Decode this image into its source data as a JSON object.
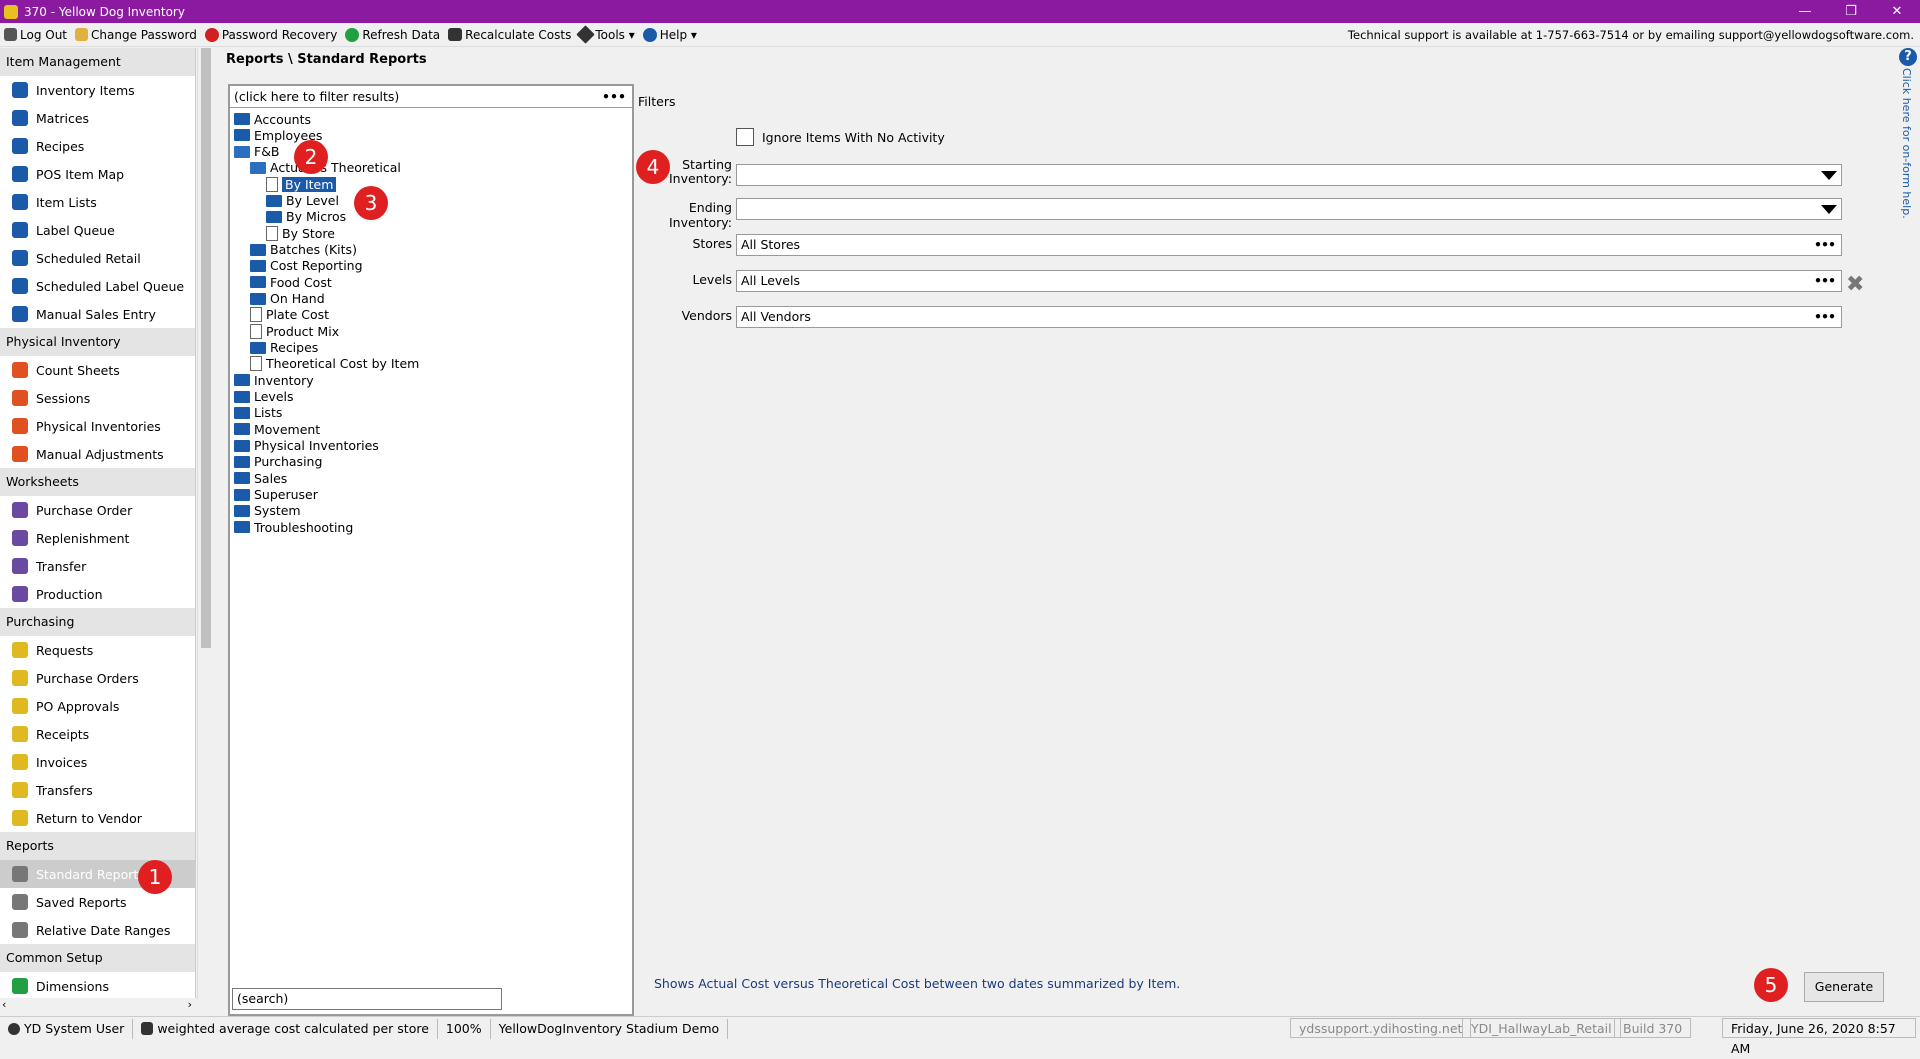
{
  "window": {
    "title": "370 - Yellow Dog Inventory",
    "minimize": "—",
    "restore": "❐",
    "close": "✕"
  },
  "toolbar": {
    "items": [
      "Log Out",
      "Change Password",
      "Password Recovery",
      "Refresh Data",
      "Recalculate Costs",
      "Tools ▾",
      "Help ▾"
    ],
    "support_text": "Technical support is available at 1-757-663-7514 or by emailing support@yellowdogsoftware.com."
  },
  "help_strip": {
    "text": "Click here for on-form help.",
    "icon": "?"
  },
  "sidebar": {
    "sections": [
      {
        "header": "Item Management",
        "items": [
          "Inventory Items",
          "Matrices",
          "Recipes",
          "POS Item Map",
          "Item Lists",
          "Label Queue",
          "Scheduled Retail",
          "Scheduled Label Queue",
          "Manual Sales Entry"
        ]
      },
      {
        "header": "Physical Inventory",
        "items": [
          "Count Sheets",
          "Sessions",
          "Physical Inventories",
          "Manual Adjustments"
        ]
      },
      {
        "header": "Worksheets",
        "items": [
          "Purchase Order",
          "Replenishment",
          "Transfer",
          "Production"
        ]
      },
      {
        "header": "Purchasing",
        "items": [
          "Requests",
          "Purchase Orders",
          "PO Approvals",
          "Receipts",
          "Invoices",
          "Transfers",
          "Return to Vendor"
        ]
      },
      {
        "header": "Reports",
        "items": [
          "Standard Reports",
          "Saved Reports",
          "Relative Date Ranges"
        ]
      },
      {
        "header": "Common Setup",
        "items": [
          "Dimensions"
        ]
      }
    ],
    "selected": "Standard Reports"
  },
  "breadcrumb": "Reports \\ Standard Reports",
  "tree": {
    "filter_placeholder": "(click here to filter results)",
    "filter_button": "•••",
    "search_value": "(search)",
    "nodes": [
      {
        "label": "Accounts",
        "type": "folder",
        "depth": 0
      },
      {
        "label": "Employees",
        "type": "folder",
        "depth": 0
      },
      {
        "label": "F&B",
        "type": "folder-open",
        "depth": 0
      },
      {
        "label": "Actual vs Theoretical",
        "type": "folder-open",
        "depth": 1
      },
      {
        "label": "By Item",
        "type": "doc",
        "depth": 2,
        "selected": true
      },
      {
        "label": "By Level",
        "type": "folder",
        "depth": 2
      },
      {
        "label": "By Micros",
        "type": "folder",
        "depth": 2
      },
      {
        "label": "By Store",
        "type": "doc",
        "depth": 2
      },
      {
        "label": "Batches (Kits)",
        "type": "folder",
        "depth": 1
      },
      {
        "label": "Cost Reporting",
        "type": "folder",
        "depth": 1
      },
      {
        "label": "Food Cost",
        "type": "folder",
        "depth": 1
      },
      {
        "label": "On Hand",
        "type": "folder",
        "depth": 1
      },
      {
        "label": "Plate Cost",
        "type": "doc",
        "depth": 1
      },
      {
        "label": "Product Mix",
        "type": "doc",
        "depth": 1
      },
      {
        "label": "Recipes",
        "type": "folder",
        "depth": 1
      },
      {
        "label": "Theoretical Cost by Item",
        "type": "doc",
        "depth": 1
      },
      {
        "label": "Inventory",
        "type": "folder",
        "depth": 0
      },
      {
        "label": "Levels",
        "type": "folder",
        "depth": 0
      },
      {
        "label": "Lists",
        "type": "folder",
        "depth": 0
      },
      {
        "label": "Movement",
        "type": "folder",
        "depth": 0
      },
      {
        "label": "Physical Inventories",
        "type": "folder",
        "depth": 0
      },
      {
        "label": "Purchasing",
        "type": "folder",
        "depth": 0
      },
      {
        "label": "Sales",
        "type": "folder",
        "depth": 0
      },
      {
        "label": "Superuser",
        "type": "folder",
        "depth": 0
      },
      {
        "label": "System",
        "type": "folder",
        "depth": 0
      },
      {
        "label": "Troubleshooting",
        "type": "folder",
        "depth": 0
      }
    ]
  },
  "filters": {
    "title": "Filters",
    "ignore_label": "Ignore Items With No Activity",
    "starting_label": "Starting Inventory:",
    "starting_value": "",
    "ending_label": "Ending Inventory:",
    "ending_value": "",
    "stores_label": "Stores",
    "stores_value": "All Stores",
    "levels_label": "Levels",
    "levels_value": "All Levels",
    "vendors_label": "Vendors",
    "vendors_value": "All Vendors",
    "dots": "•••",
    "clear": "✖"
  },
  "description": "Shows Actual Cost versus Theoretical Cost between two dates summarized by Item.",
  "generate_label": "Generate",
  "badges": [
    "1",
    "2",
    "3",
    "4",
    "5"
  ],
  "statusbar": {
    "user": "YD System User",
    "costing": "weighted average cost calculated per store",
    "zoom": "100%",
    "database": "YellowDogInventory Stadium Demo",
    "host": "ydssupport.ydihosting.net",
    "location": "YDI_HallwayLab_Retail",
    "build": "Build 370",
    "datetime": "Friday, June 26, 2020 8:57 AM"
  },
  "colors": {
    "titlebar": "#8c1aa0",
    "accent": "#1a5aa8",
    "badge": "#e02020"
  }
}
